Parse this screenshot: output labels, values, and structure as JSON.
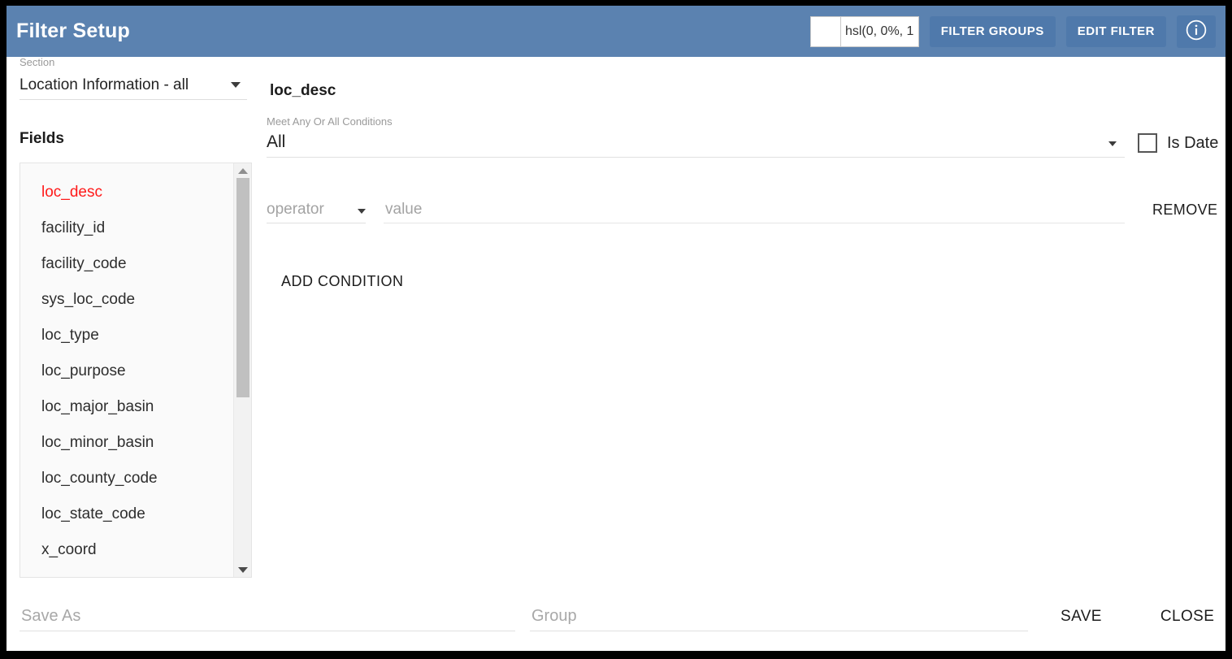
{
  "header": {
    "title": "Filter Setup",
    "color_field": {
      "swatch_color": "#ffffff",
      "value": "hsl(0, 0%, 1"
    },
    "filter_groups_label": "FILTER GROUPS",
    "edit_filter_label": "EDIT FILTER",
    "info_icon": "info-circle-icon",
    "background_color": "#5b82b0",
    "button_color": "#4f79ab"
  },
  "sidebar": {
    "section": {
      "label": "Section",
      "value": "Location Information - all",
      "caret_icon": "chevron-down-icon"
    },
    "fields_title": "Fields",
    "selected_field": "loc_desc",
    "selected_color": "#ff1a1a",
    "fields": [
      {
        "label": "loc_desc"
      },
      {
        "label": "facility_id"
      },
      {
        "label": "facility_code"
      },
      {
        "label": "sys_loc_code"
      },
      {
        "label": "loc_type"
      },
      {
        "label": "loc_purpose"
      },
      {
        "label": "loc_major_basin"
      },
      {
        "label": "loc_minor_basin"
      },
      {
        "label": "loc_county_code"
      },
      {
        "label": "loc_state_code"
      },
      {
        "label": "x_coord"
      }
    ],
    "scrollbar": {
      "up_icon": "scroll-up-arrow-icon",
      "down_icon": "scroll-down-arrow-icon"
    }
  },
  "main": {
    "field_title": "loc_desc",
    "meet_conditions": {
      "label": "Meet Any Or All Conditions",
      "value": "All",
      "caret_icon": "chevron-down-icon"
    },
    "is_date": {
      "label": "Is Date",
      "checked": false
    },
    "condition": {
      "operator_placeholder": "operator",
      "operator_value": "",
      "operator_caret_icon": "chevron-down-icon",
      "value_placeholder": "value",
      "value_value": "",
      "remove_label": "REMOVE"
    },
    "add_condition_label": "ADD CONDITION"
  },
  "footer": {
    "save_as_placeholder": "Save As",
    "save_as_value": "",
    "group_placeholder": "Group",
    "group_value": "",
    "save_label": "SAVE",
    "close_label": "CLOSE"
  }
}
